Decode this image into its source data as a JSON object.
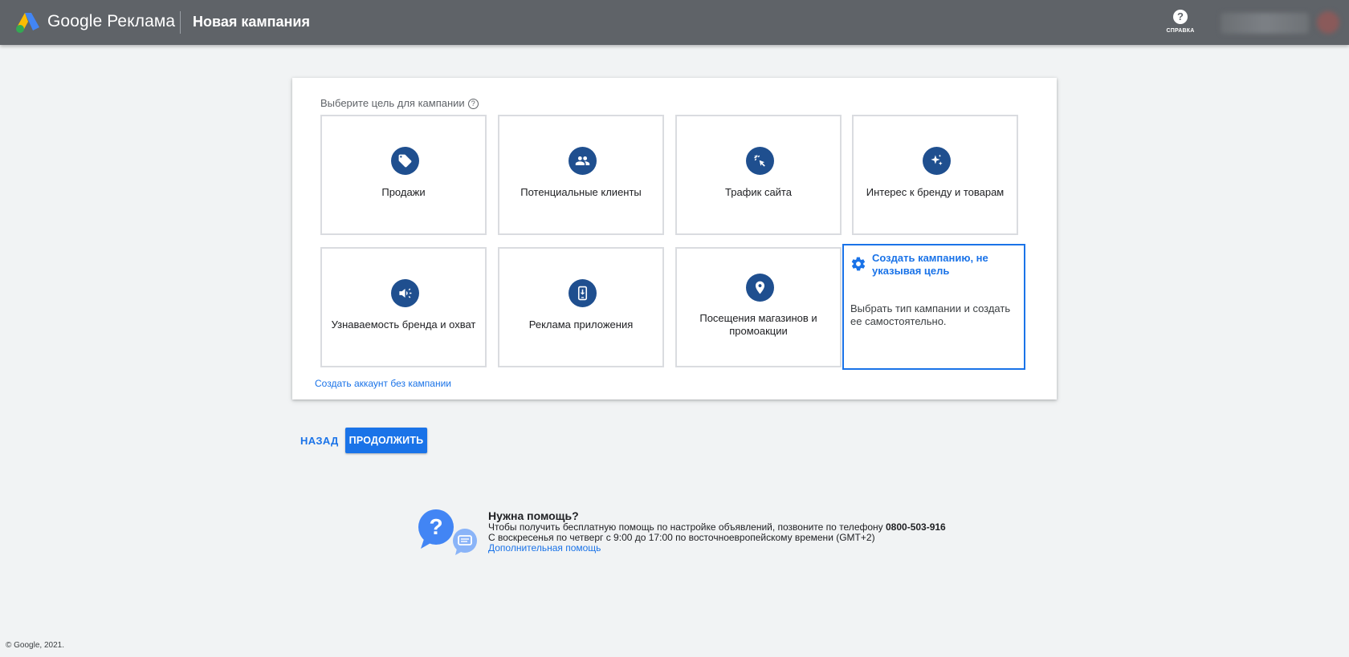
{
  "header": {
    "brand": "Google Реклама",
    "title": "Новая кампания",
    "help_label": "СПРАВКА"
  },
  "card": {
    "heading": "Выберите цель для кампании",
    "goals": [
      {
        "label": "Продажи",
        "icon": "tag-icon"
      },
      {
        "label": "Потенциальные клиенты",
        "icon": "people-icon"
      },
      {
        "label": "Трафик сайта",
        "icon": "cursor-click-icon"
      },
      {
        "label": "Интерес к бренду и товарам",
        "icon": "sparkle-icon"
      },
      {
        "label": "Узнаваемость бренда и охват",
        "icon": "megaphone-icon"
      },
      {
        "label": "Реклама приложения",
        "icon": "phone-download-icon"
      },
      {
        "label": "Посещения магазинов и промоакции",
        "icon": "location-pin-icon"
      }
    ],
    "no_goal": {
      "title": "Создать кампанию, не указывая цель",
      "description": "Выбрать тип кампании и создать ее самостоятельно.",
      "icon": "gear-icon"
    },
    "no_campaign_link": "Создать аккаунт без кампании"
  },
  "buttons": {
    "back": "НАЗАД",
    "continue": "ПРОДОЛЖИТЬ"
  },
  "help": {
    "title": "Нужна помощь?",
    "line1": "Чтобы получить бесплатную помощь по настройке объявлений, позвоните по телефону ",
    "phone": "0800-503-916",
    "line2": "С воскресенья по четверг с 9:00 до 17:00 по восточноевропейскому времени (GMT+2)",
    "link": "Дополнительная помощь"
  },
  "footer": "© Google, 2021.",
  "colors": {
    "header_bg": "#5f6368",
    "accent": "#1a73e8",
    "icon_bg": "#1f4f8f",
    "page_bg": "#f1f3f4"
  }
}
